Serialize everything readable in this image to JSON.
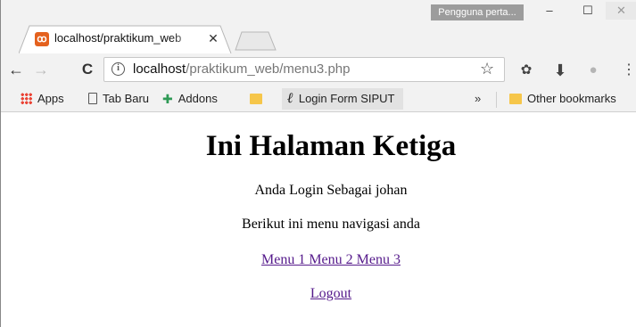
{
  "window": {
    "user_badge": "Pengguna perta...",
    "minimize_glyph": "–",
    "maximize_glyph": "☐",
    "close_glyph": "✕"
  },
  "tab": {
    "title": "localhost/praktikum_web",
    "favicon_glyph": "ꝏ",
    "close_glyph": "✕"
  },
  "toolbar": {
    "back_glyph": "←",
    "forward_glyph": "→",
    "reload_glyph": "C",
    "url_host": "localhost",
    "url_path": "/praktikum_web/menu3.php",
    "star_glyph": "☆",
    "extension_glyphs": [
      "✿",
      "⬇",
      "●"
    ],
    "menu_glyph": "⋮"
  },
  "bookmarks": {
    "items": [
      {
        "label": "Apps",
        "icon": "apps-grid-icon"
      },
      {
        "label": "Tab Baru",
        "icon": "page-icon"
      },
      {
        "label": "Addons",
        "icon": "puzzle-icon"
      },
      {
        "label": "",
        "icon": "folder-icon"
      },
      {
        "label": "Login Form SIPUT",
        "icon": "script-l-icon"
      }
    ],
    "overflow_glyph": "»",
    "other_label": "Other bookmarks",
    "script_glyph": "ℓ",
    "puzzle_glyph": "✚"
  },
  "page": {
    "heading": "Ini Halaman Ketiga",
    "login_text": "Anda Login Sebagai johan",
    "nav_text": "Berikut ini menu navigasi anda",
    "menu_links": [
      "Menu 1 Menu 2 Menu 3 "
    ],
    "logout_label": "Logout"
  },
  "colors": {
    "chrome_bg": "#f2f2f2",
    "link_visited": "#551a8b",
    "favicon": "#e4611e",
    "folder": "#f6c64a",
    "puzzle": "#2e9a55"
  }
}
